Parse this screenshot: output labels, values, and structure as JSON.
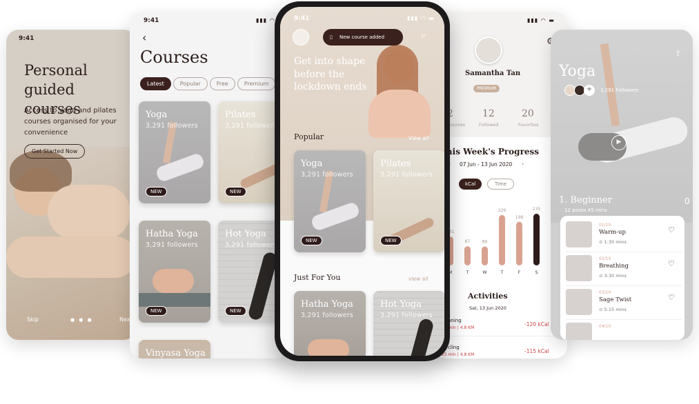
{
  "status": {
    "time": "9:41"
  },
  "onboarding": {
    "title": "Personal guided courses",
    "desc": "Access to yoga and pilates courses organised for your convenience",
    "cta": "Get Started Now",
    "skip": "Skip",
    "next": "Next"
  },
  "courses_screen": {
    "title": "Courses",
    "filters": [
      "Latest",
      "Popular",
      "Free",
      "Premium"
    ],
    "items": [
      {
        "name": "Yoga",
        "followers": "3,291 followers",
        "badge": "NEW"
      },
      {
        "name": "Pilates",
        "followers": "3,291 followers",
        "badge": "NEW"
      },
      {
        "name": "Hatha Yoga",
        "followers": "3,291 followers",
        "badge": "NEW"
      },
      {
        "name": "Hot Yoga",
        "followers": "3,291 followers",
        "badge": "NEW"
      },
      {
        "name": "Vinyasa Yoga",
        "followers": ""
      }
    ]
  },
  "home": {
    "toast": "New course added",
    "hero": "Get into shape before the lockdown ends",
    "popular_title": "Popular",
    "view_all": "View all",
    "view_all_2": "view all",
    "foryou_title": "Just For You",
    "popular": [
      {
        "name": "Yoga",
        "followers": "3,291 followers",
        "badge": "NEW"
      },
      {
        "name": "Pilates",
        "followers": "3,291 followers",
        "badge": "NEW"
      }
    ],
    "foryou": [
      {
        "name": "Hatha Yoga",
        "followers": "3,291 followers"
      },
      {
        "name": "Hot Yoga",
        "followers": "3,291 followers"
      }
    ]
  },
  "profile": {
    "name": "Samantha Tan",
    "badge": "PREMIUM",
    "stats": [
      {
        "value": "2",
        "label": "Courses"
      },
      {
        "value": "12",
        "label": "Followed"
      },
      {
        "value": "20",
        "label": "Favorites"
      }
    ],
    "progress_title": "This Week's Progress",
    "range": "07 Jun - 13 Jun 2020",
    "toggle": [
      "kCal",
      "Time"
    ],
    "chart_data": {
      "type": "bar",
      "categories": [
        "M",
        "T",
        "W",
        "T",
        "F",
        "S"
      ],
      "values": [
        131,
        87,
        86,
        229,
        198,
        235
      ],
      "value_labels": [
        "131",
        "87",
        "86",
        "229",
        "198",
        "235"
      ]
    },
    "activities_title": "Activities",
    "activities_date": "Sat, 13 Jun 2020",
    "activities": [
      {
        "name": "Running",
        "meta": "25 min | 4.8 KM",
        "kcal": "-120 kCal"
      },
      {
        "name": "Cycling",
        "meta": "25 min | 4.8 KM",
        "kcal": "-115 kCal"
      }
    ]
  },
  "detail": {
    "title": "Yoga",
    "followers": "3,291 Followers",
    "level": "1. Beginner",
    "meta": "12 poses  45 mins",
    "side_num": "0",
    "poses": [
      {
        "num": "01/10",
        "name": "Warm-up",
        "dur": "1:30 mins"
      },
      {
        "num": "02/10",
        "name": "Breathing",
        "dur": "3:30 mins"
      },
      {
        "num": "03/10",
        "name": "Sage Twist",
        "dur": "5:15 mins"
      },
      {
        "num": "04/10",
        "name": "",
        "dur": ""
      }
    ]
  },
  "colors": {
    "dark": "#2f1c1a",
    "accent": "#d9a290",
    "bar_dark": "#2f1c1a",
    "red": "#d0454a",
    "beige": "#ece3db"
  }
}
